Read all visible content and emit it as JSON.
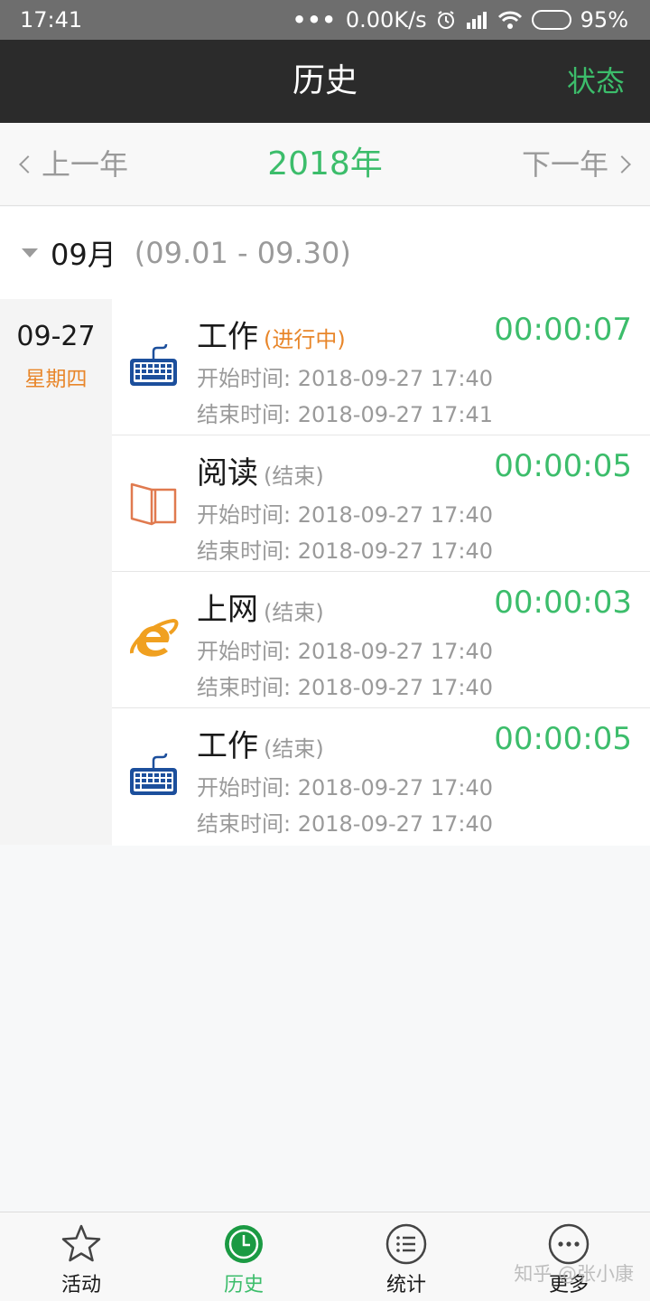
{
  "status_bar": {
    "time": "17:41",
    "dots": "•••",
    "speed": "0.00K/s",
    "battery": "95%",
    "battery_level": 0.95
  },
  "app_bar": {
    "title": "历史",
    "action": "状态"
  },
  "year_nav": {
    "prev": "上一年",
    "year": "2018年",
    "next": "下一年"
  },
  "month": {
    "name": "09月",
    "range": "(09.01 - 09.30)"
  },
  "day": {
    "date": "09-27",
    "weekday": "星期四"
  },
  "entries": [
    {
      "icon": "keyboard-icon",
      "name": "工作",
      "status": "(进行中)",
      "running": true,
      "duration": "00:00:07",
      "start": "开始时间: 2018-09-27 17:40",
      "end": "结束时间: 2018-09-27 17:41"
    },
    {
      "icon": "book-icon",
      "name": "阅读",
      "status": "(结束)",
      "running": false,
      "duration": "00:00:05",
      "start": "开始时间: 2018-09-27 17:40",
      "end": "结束时间: 2018-09-27 17:40"
    },
    {
      "icon": "internet-explorer-icon",
      "name": "上网",
      "status": "(结束)",
      "running": false,
      "duration": "00:00:03",
      "start": "开始时间: 2018-09-27 17:40",
      "end": "结束时间: 2018-09-27 17:40"
    },
    {
      "icon": "keyboard-icon",
      "name": "工作",
      "status": "(结束)",
      "running": false,
      "duration": "00:00:05",
      "start": "开始时间: 2018-09-27 17:40",
      "end": "结束时间: 2018-09-27 17:40"
    }
  ],
  "bottom_nav": [
    {
      "label": "活动",
      "icon": "star-icon",
      "active": false
    },
    {
      "label": "历史",
      "icon": "clock-icon",
      "active": true
    },
    {
      "label": "统计",
      "icon": "list-icon",
      "active": false
    },
    {
      "label": "更多",
      "icon": "more-icon",
      "active": false
    }
  ],
  "watermark": "知乎 @张小康",
  "colors": {
    "accent_green": "#3cbd6b",
    "accent_orange": "#e8862a",
    "app_bar_bg": "#2b2b2b",
    "keyboard_blue": "#1c4f9c",
    "book_orange": "#e07a4f",
    "ie_orange": "#f0a020"
  }
}
